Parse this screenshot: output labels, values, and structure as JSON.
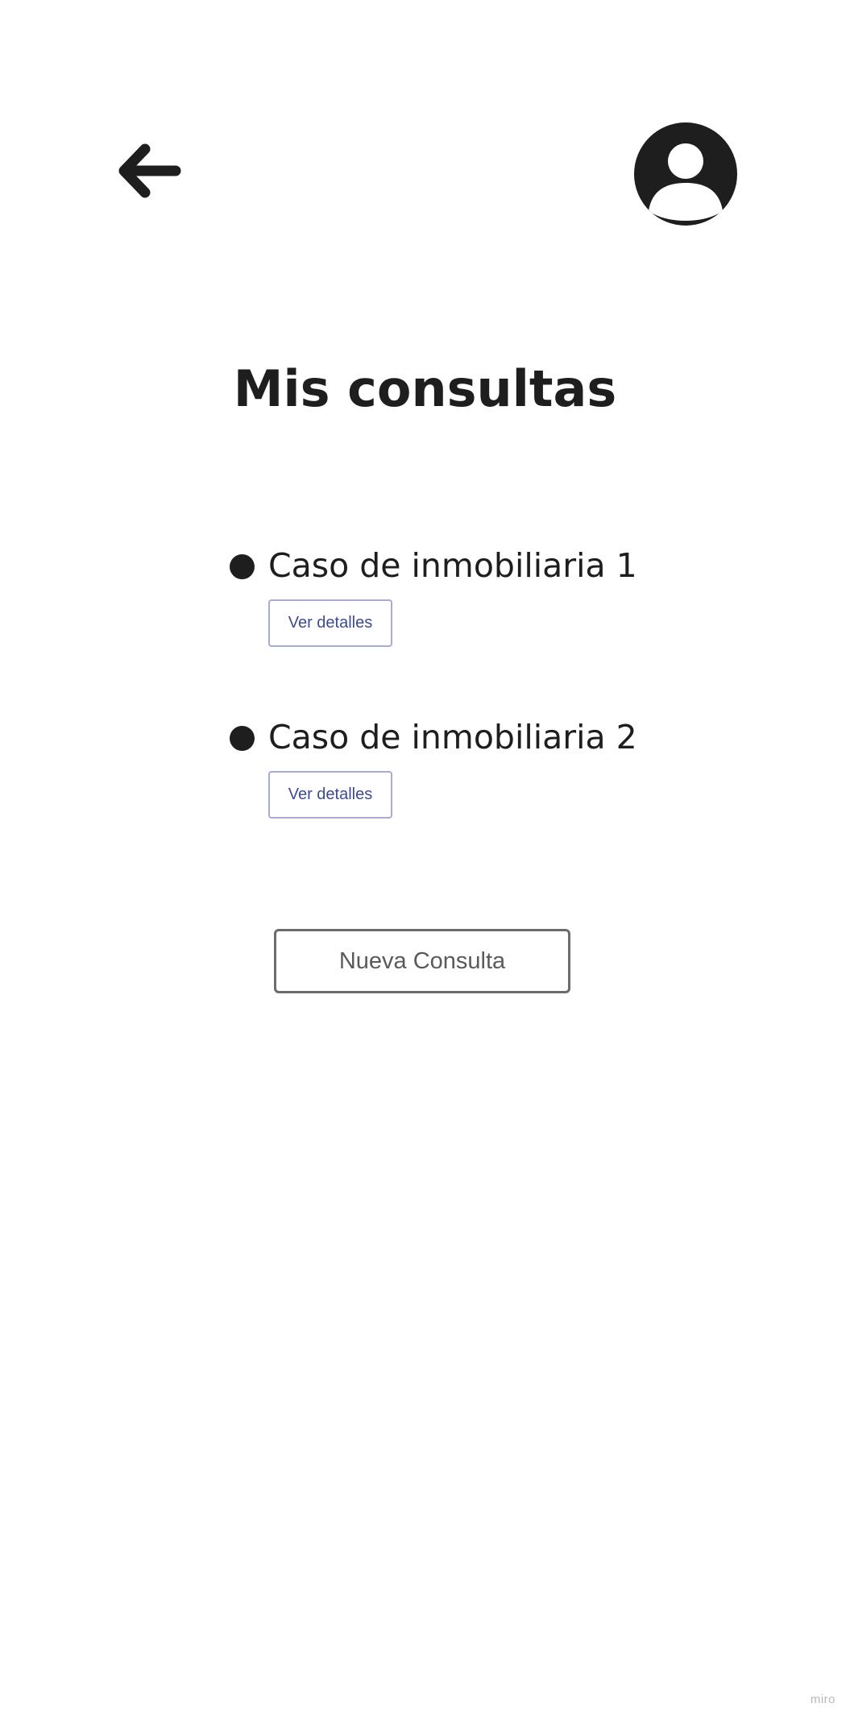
{
  "header": {
    "back_icon": "arrow-left-icon",
    "profile_icon": "user-circle-icon"
  },
  "page": {
    "title": "Mis consultas"
  },
  "cases": [
    {
      "label": "Caso de inmobiliaria 1",
      "button_label": "Ver detalles"
    },
    {
      "label": "Caso de inmobiliaria 2",
      "button_label": "Ver detalles"
    }
  ],
  "actions": {
    "new_consult_label": "Nueva Consulta"
  },
  "footer": {
    "watermark": "miro"
  },
  "colors": {
    "text": "#1e1e1e",
    "link_text": "#3e4a94",
    "link_border": "#a9aad6",
    "button_border": "#6b6b6b",
    "button_text": "#5a5a5a",
    "background": "#ffffff"
  }
}
